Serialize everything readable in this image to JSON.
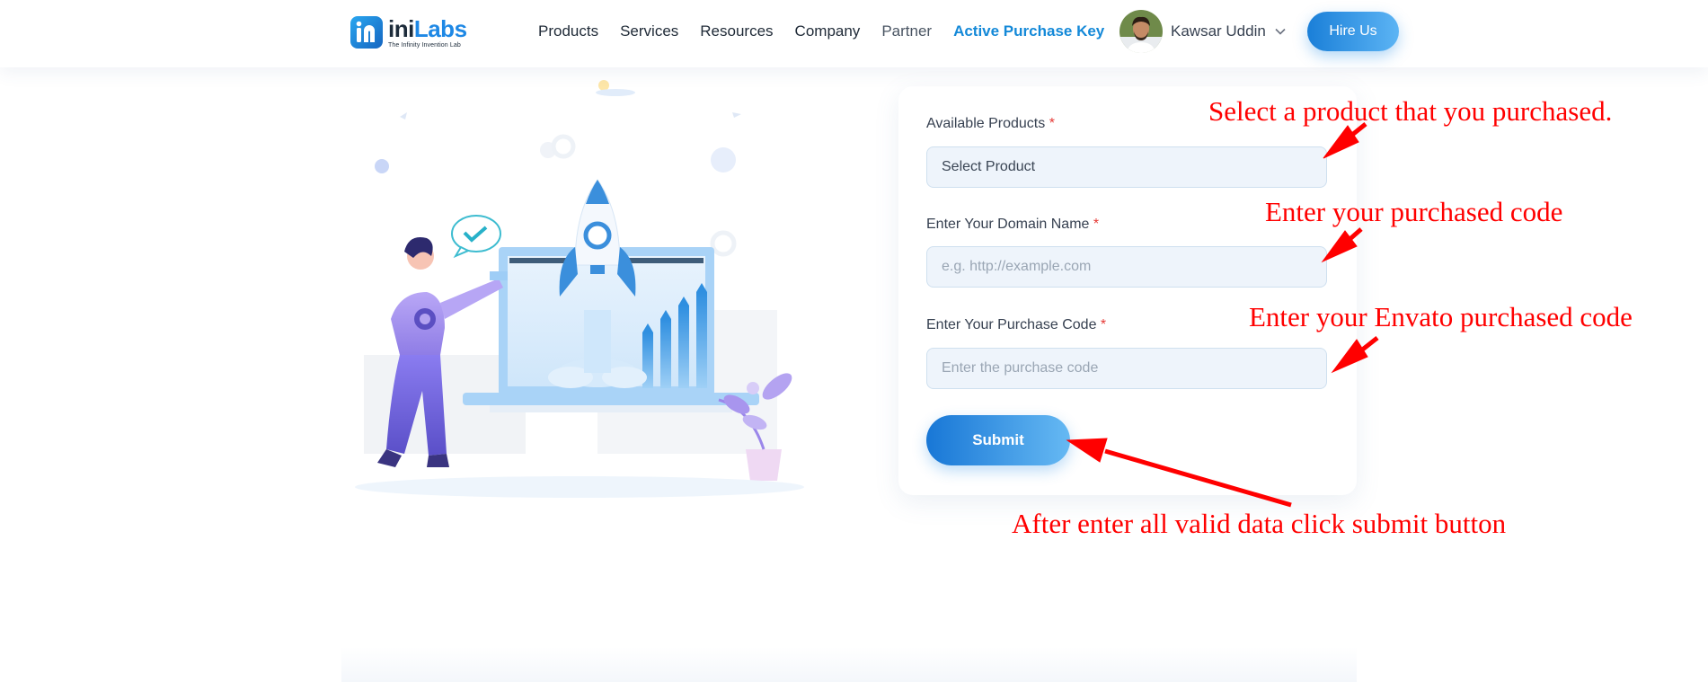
{
  "header": {
    "logo": {
      "name_part1": "ini",
      "name_part2": "Labs",
      "tagline": "The Infinity Invention Lab",
      "icon": "inilabs-logo-icon"
    },
    "nav": [
      {
        "label": "Products"
      },
      {
        "label": "Services"
      },
      {
        "label": "Resources"
      },
      {
        "label": "Company"
      },
      {
        "label": "Partner"
      },
      {
        "label": "Active Purchase Key"
      }
    ],
    "user": {
      "name": "Kawsar Uddin",
      "avatar_icon": "user-avatar",
      "dropdown_icon": "chevron-down-icon"
    },
    "hire_button": "Hire Us"
  },
  "form": {
    "product": {
      "label": "Available Products",
      "required_mark": "*",
      "value": "Select Product"
    },
    "domain": {
      "label": "Enter Your Domain Name",
      "required_mark": "*",
      "placeholder": "e.g. http://example.com"
    },
    "code": {
      "label": "Enter Your Purchase Code",
      "required_mark": "*",
      "placeholder": "Enter the purchase code"
    },
    "submit_label": "Submit"
  },
  "annotations": {
    "product": "Select a product that you purchased.",
    "domain": "Enter your purchased code",
    "code": "Enter your Envato purchased code",
    "submit": "After enter all valid data click submit button"
  },
  "colors": {
    "accent": "#1489d8",
    "button_start": "#1877d6",
    "button_end": "#66b9f3",
    "annotation": "#ff0000",
    "required": "#e53935"
  },
  "illustration": {
    "icon": "rocket-launch-illustration"
  }
}
